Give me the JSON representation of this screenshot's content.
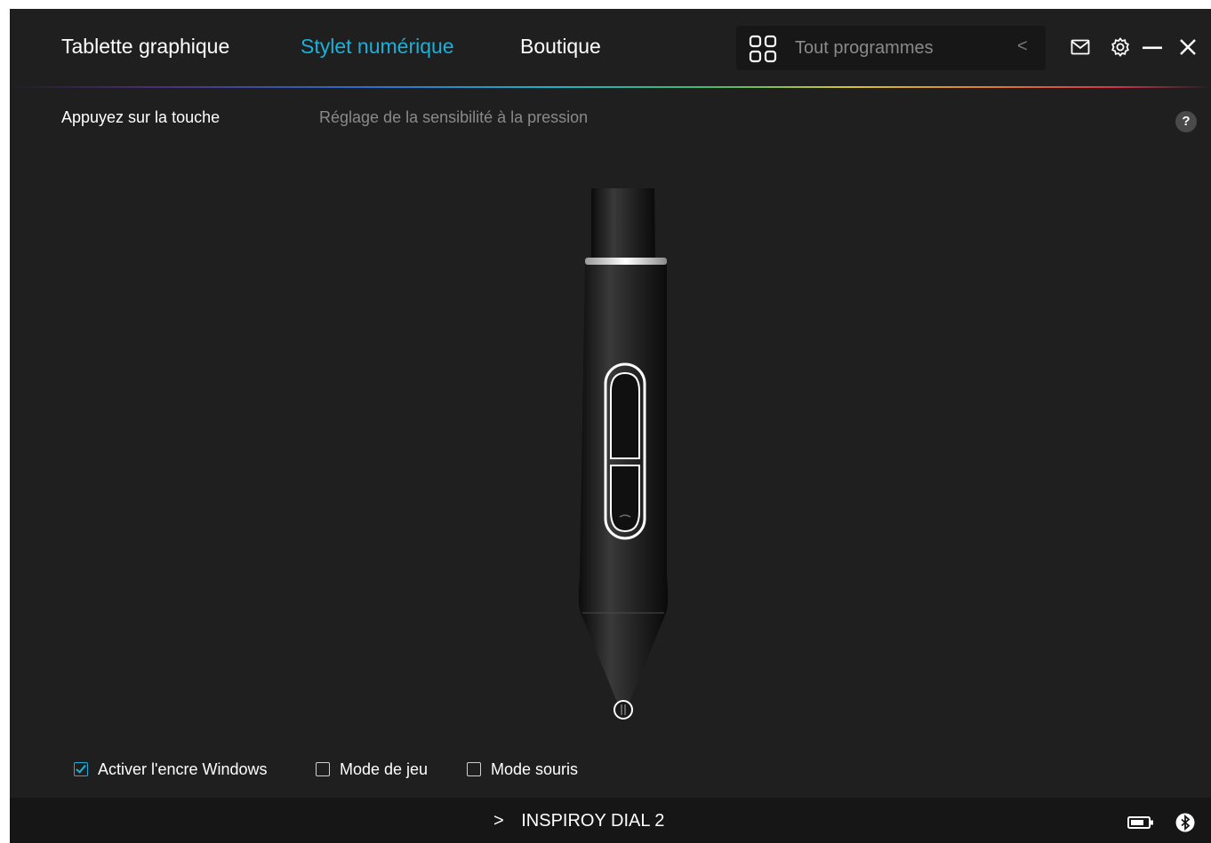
{
  "nav": {
    "tabs": [
      {
        "label": "Tablette graphique",
        "active": false
      },
      {
        "label": "Stylet numérique",
        "active": true
      },
      {
        "label": "Boutique",
        "active": false
      }
    ]
  },
  "program_selector": {
    "icon": "grid-icon",
    "value": "Tout programmes",
    "chevron": "<"
  },
  "window_controls": [
    "mail-icon",
    "gear-icon",
    "minimize-icon",
    "close-icon"
  ],
  "subtabs": [
    {
      "label": "Appuyez sur la touche",
      "active": true
    },
    {
      "label": "Réglage de la sensibilité à la pression",
      "active": false
    }
  ],
  "help": {
    "label": "?"
  },
  "options": [
    {
      "label": "Activer l'encre Windows",
      "checked": true
    },
    {
      "label": "Mode de jeu",
      "checked": false
    },
    {
      "label": "Mode souris",
      "checked": false
    }
  ],
  "footer": {
    "chevron": ">",
    "device_name": "INSPIROY DIAL 2",
    "battery_icon": "battery-icon",
    "bluetooth_icon": "bluetooth-icon"
  },
  "colors": {
    "background": "#1f1f1f",
    "accent": "#1bb0d8",
    "footer": "#161616"
  }
}
